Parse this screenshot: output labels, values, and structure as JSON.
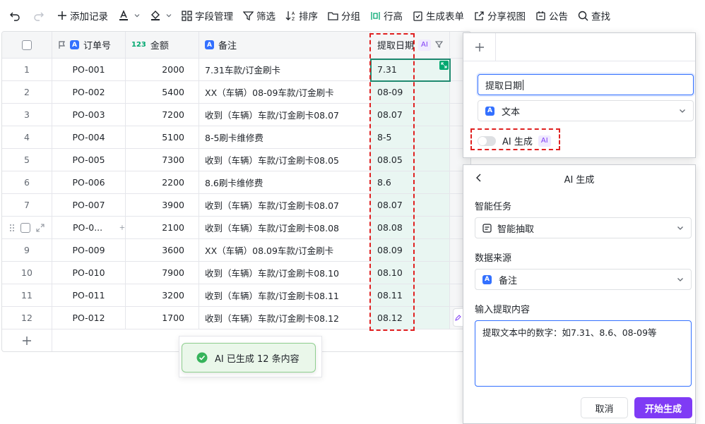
{
  "toolbar": {
    "add_record": "添加记录",
    "field_manage": "字段管理",
    "filter": "筛选",
    "sort": "排序",
    "group": "分组",
    "row_height": "行高",
    "create_form": "生成表单",
    "share_view": "分享视图",
    "announcement": "公告",
    "search": "查找"
  },
  "colors": {
    "accent": "#3370ff",
    "ai_purple": "#7f3bf5",
    "highlight_red": "#e02020",
    "column_tint": "#e9f6f2",
    "success_green": "#36b35b"
  },
  "table": {
    "headers": {
      "order": "订单号",
      "amount": "金额",
      "amount_badge": "123",
      "note": "备注",
      "extract_date": "提取日期",
      "ai_badge": "AI",
      "text_badge": "A"
    },
    "rows": [
      {
        "idx": "1",
        "order": "PO-001",
        "amount": "2000",
        "note": "7.31车款/订金刷卡",
        "date": "7.31"
      },
      {
        "idx": "2",
        "order": "PO-002",
        "amount": "5400",
        "note": "XX（车辆）08-09车款/订金刷卡",
        "date": "08-09"
      },
      {
        "idx": "3",
        "order": "PO-003",
        "amount": "7200",
        "note": "收到（车辆）车款/订金刷卡08.07",
        "date": "08.07"
      },
      {
        "idx": "4",
        "order": "PO-004",
        "amount": "5100",
        "note": "8-5刷卡维修费",
        "date": "8-5"
      },
      {
        "idx": "5",
        "order": "PO-005",
        "amount": "7300",
        "note": "收到（车辆）车款/订金刷卡08.05",
        "date": "08.05"
      },
      {
        "idx": "6",
        "order": "PO-006",
        "amount": "2200",
        "note": "8.6刷卡维修费",
        "date": "8.6"
      },
      {
        "idx": "7",
        "order": "PO-007",
        "amount": "3900",
        "note": "收到（车辆）车款/订金刷卡08.07",
        "date": "08.07"
      },
      {
        "idx": "",
        "order": "PO-0...",
        "amount": "2100",
        "note": "收到（车辆）车款/订金刷卡08.08",
        "date": "08.08"
      },
      {
        "idx": "9",
        "order": "PO-009",
        "amount": "3600",
        "note": "XX（车辆）08.09车款/订金刷卡",
        "date": "08.09"
      },
      {
        "idx": "10",
        "order": "PO-010",
        "amount": "7900",
        "note": "收到（车辆）车款/订金刷卡08.10",
        "date": "08.10"
      },
      {
        "idx": "11",
        "order": "PO-011",
        "amount": "3200",
        "note": "收到（车辆）车款/订金刷卡08.11",
        "date": "08.11"
      },
      {
        "idx": "12",
        "order": "PO-012",
        "amount": "1700",
        "note": "收到（车辆）车款/订金刷卡08.12",
        "date": "08.12"
      }
    ]
  },
  "toast": {
    "message": "AI 已生成 12 条内容"
  },
  "field_panel": {
    "name_value": "提取日期",
    "type_badge": "A",
    "type_value": "文本",
    "ai_toggle_label": "AI 生成",
    "ai_badge": "AI"
  },
  "ai_panel": {
    "title": "AI 生成",
    "task_label": "智能任务",
    "task_value": "智能抽取",
    "source_label": "数据来源",
    "source_badge": "A",
    "source_value": "备注",
    "input_label": "输入提取内容",
    "input_value": "提取文本中的数字：如7.31、8.6、08-09等",
    "cancel": "取消",
    "start": "开始生成"
  }
}
